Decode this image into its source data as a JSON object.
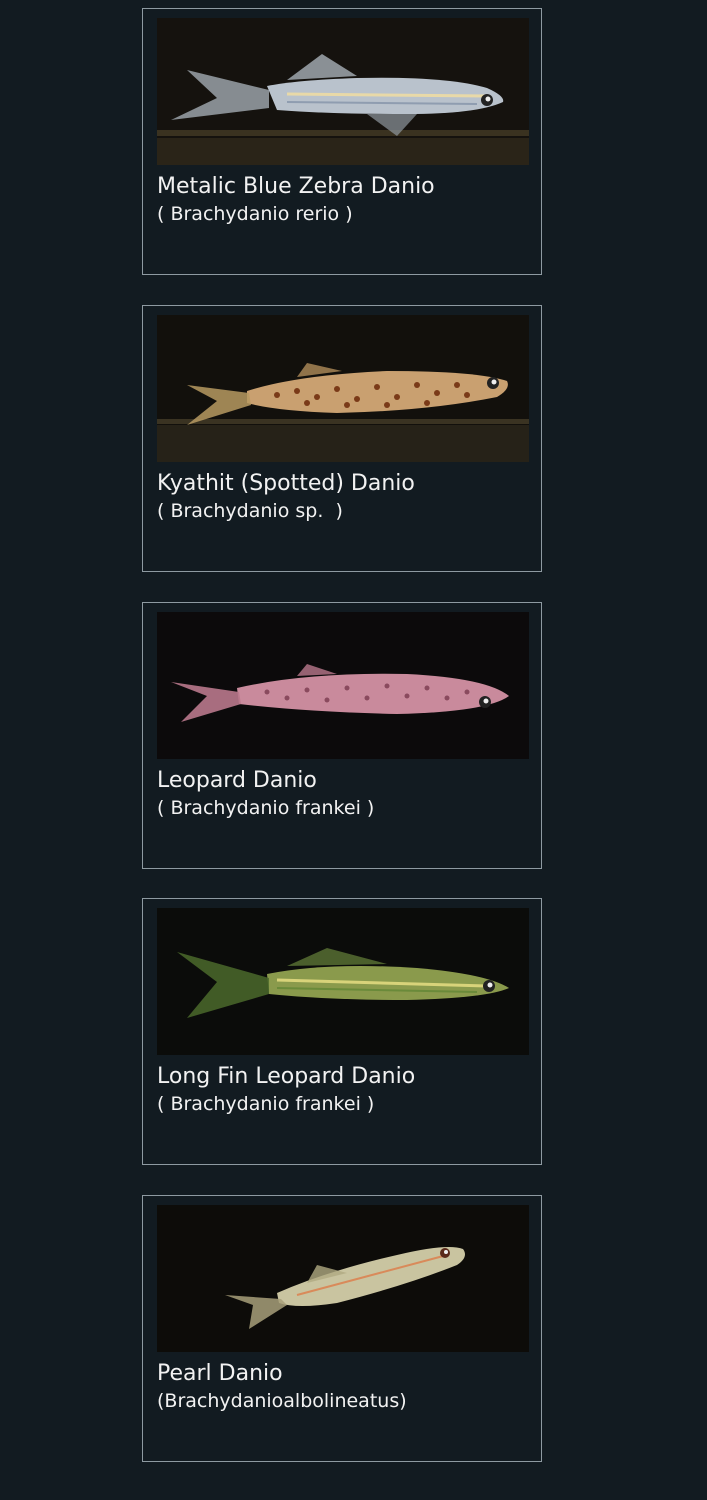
{
  "fish": [
    {
      "common_name": "Metalic Blue Zebra Danio",
      "scientific_name": "( Brachydanio rerio )"
    },
    {
      "common_name": "Kyathit (Spotted) Danio",
      "scientific_name": "( Brachydanio sp.  )"
    },
    {
      "common_name": "Leopard Danio",
      "scientific_name": "( Brachydanio frankei )"
    },
    {
      "common_name": "Long Fin Leopard Danio",
      "scientific_name": "( Brachydanio frankei )"
    },
    {
      "common_name": "Pearl Danio",
      "scientific_name": "(Brachydanioalbolineatus)"
    }
  ],
  "colors": {
    "background": "#121b21",
    "card_border": "#8e9aa1",
    "text": "#f2f2f2"
  }
}
